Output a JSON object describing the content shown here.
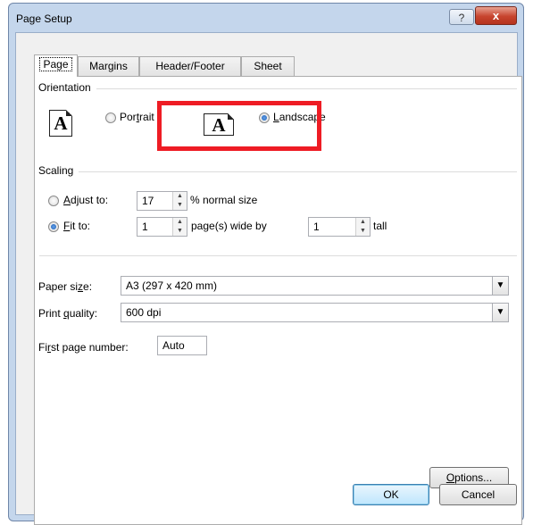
{
  "window": {
    "title": "Page Setup",
    "help_symbol": "?",
    "close_symbol": "x"
  },
  "tabs": [
    {
      "label": "Page",
      "active": true
    },
    {
      "label": "Margins"
    },
    {
      "label": "Header/Footer"
    },
    {
      "label": "Sheet"
    }
  ],
  "orientation": {
    "group_label": "Orientation",
    "icon_letter": "A",
    "portrait": {
      "label_pre": "Por",
      "label_u": "t",
      "label_post": "rait",
      "checked": false
    },
    "landscape": {
      "label_pre": "",
      "label_u": "L",
      "label_post": "andscape",
      "checked": true
    }
  },
  "scaling": {
    "group_label": "Scaling",
    "adjust_to": {
      "label_u": "A",
      "label_post": "djust to:",
      "value": "17",
      "suffix": "% normal size",
      "checked": false
    },
    "fit_to": {
      "label_u": "F",
      "label_post": "it to:",
      "wide_value": "1",
      "wide_suffix": "page(s) wide by",
      "tall_value": "1",
      "tall_suffix": "tall",
      "checked": true
    }
  },
  "paper_size": {
    "label_pre": "Paper si",
    "label_u": "z",
    "label_post": "e:",
    "value": "A3 (297 x 420 mm)"
  },
  "print_quality": {
    "label_pre": "Print ",
    "label_u": "q",
    "label_post": "uality:",
    "value": "600 dpi"
  },
  "first_page": {
    "label_pre": "Fi",
    "label_u": "r",
    "label_post": "st page number:",
    "value": "Auto"
  },
  "buttons": {
    "options": {
      "label_u": "O",
      "label_post": "ptions..."
    },
    "ok": "OK",
    "cancel": "Cancel"
  },
  "colors": {
    "highlight": "#ee1c24",
    "titlebar": "#c4d6ec",
    "close": "#c7442e"
  }
}
